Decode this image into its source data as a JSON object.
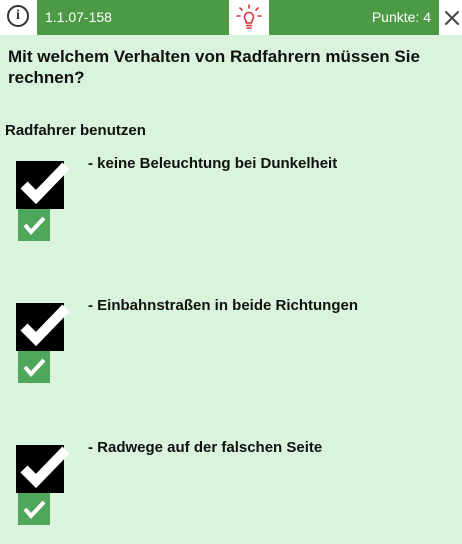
{
  "header": {
    "info_icon": "info-circle-icon",
    "question_id": "1.1.07-158",
    "hint_icon": "lightbulb-icon",
    "points_label": "Punkte: 4",
    "close_icon": "close-x-icon"
  },
  "question": {
    "text": "Mit welchem Verhalten von Radfahrern müssen Sie rechnen?",
    "prompt": "Radfahrer benutzen"
  },
  "answers": [
    {
      "label": "- keine Beleuchtung bei Dunkelheit",
      "checked": true,
      "correct": true
    },
    {
      "label": "- Einbahnstraßen in beide Richtungen",
      "checked": true,
      "correct": true
    },
    {
      "label": "- Radwege auf der falschen Seite",
      "checked": true,
      "correct": true
    }
  ],
  "colors": {
    "background": "#d9f3dc",
    "bar_green": "#4c9a46",
    "correct_green": "#4ea75a",
    "hint_red": "#d9363e"
  }
}
